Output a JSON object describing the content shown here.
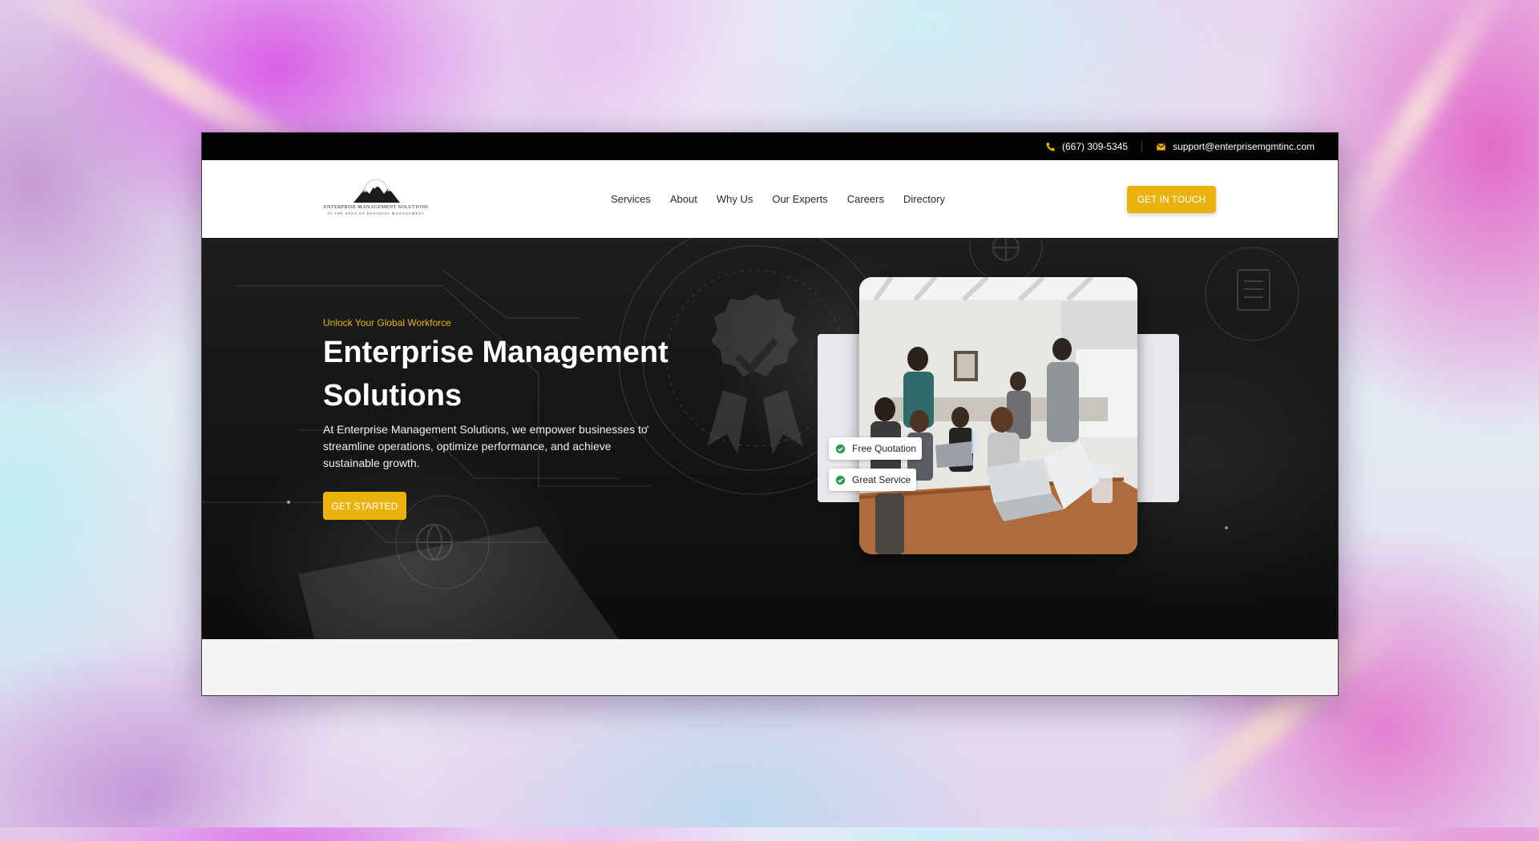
{
  "topbar": {
    "phone": "(667) 309-5345",
    "email": "support@enterprisemgmtinc.com",
    "phone_icon": "phone-icon",
    "email_icon": "mail-icon"
  },
  "logo": {
    "name": "ENTERPRISE MANAGEMENT SOLUTIONS",
    "tagline": "AT THE APEX OF BUSINESS MANAGEMENT"
  },
  "nav": {
    "items": [
      "Services",
      "About",
      "Why Us",
      "Our Experts",
      "Careers",
      "Directory"
    ],
    "cta": "GET IN TOUCH"
  },
  "hero": {
    "eyebrow": "Unlock Your Global Workforce",
    "title": "Enterprise Management Solutions",
    "description": "At Enterprise Management Solutions, we empower businesses to streamline operations, optimize performance, and achieve sustainable growth.",
    "cta": "GET STARTED",
    "badges": [
      "Free Quotation",
      "Great Service"
    ]
  },
  "colors": {
    "accent": "#e9b20d",
    "topbar_bg": "#030303",
    "hero_bg": "#141413",
    "badge_check": "#2e9b4f"
  }
}
